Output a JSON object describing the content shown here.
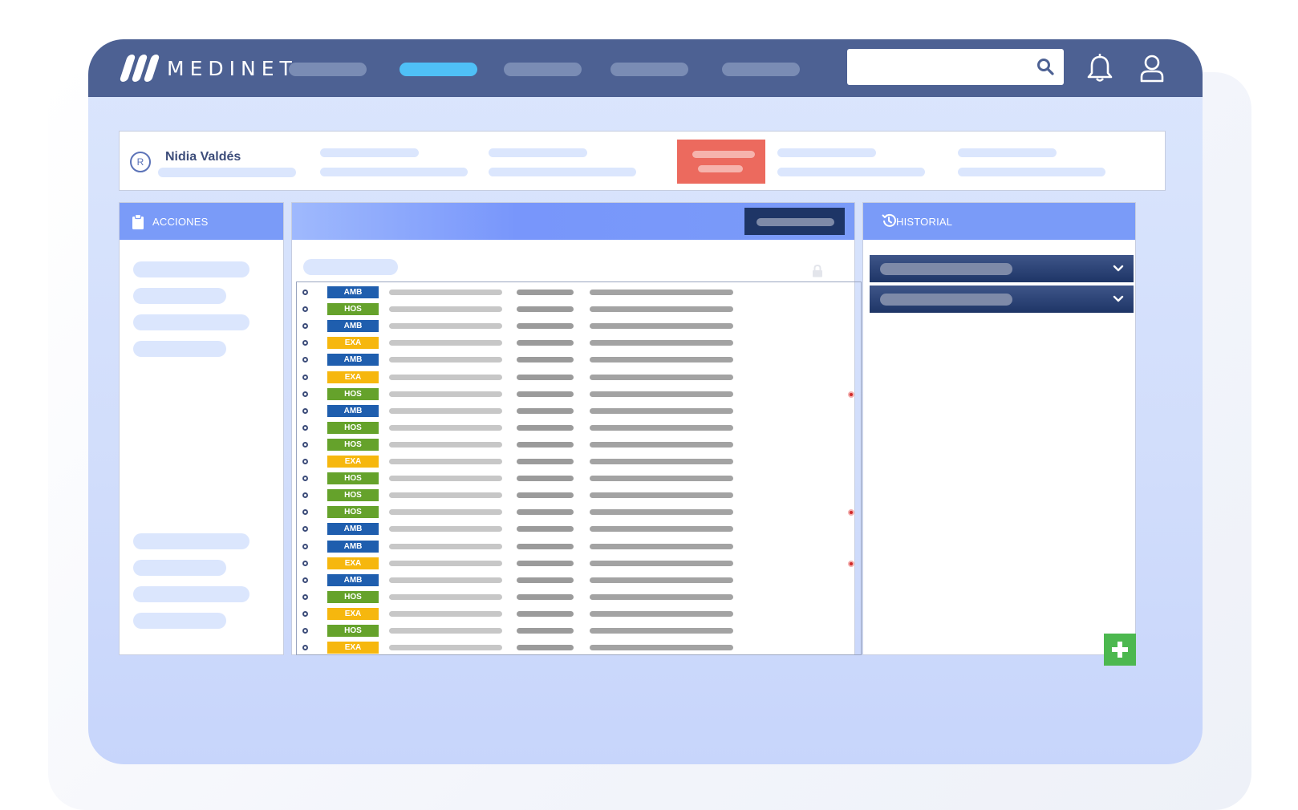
{
  "brand": {
    "logo_text": "MEDINET"
  },
  "patient": {
    "badge": "R",
    "name": "Nidia Valdés"
  },
  "panels": {
    "actions_title": "ACCIONES",
    "history_title": "HISTORIAL"
  },
  "encounters": [
    {
      "tag": "AMB",
      "alert": false
    },
    {
      "tag": "HOS",
      "alert": false
    },
    {
      "tag": "AMB",
      "alert": false
    },
    {
      "tag": "EXA",
      "alert": false
    },
    {
      "tag": "AMB",
      "alert": false
    },
    {
      "tag": "EXA",
      "alert": false
    },
    {
      "tag": "HOS",
      "alert": true
    },
    {
      "tag": "AMB",
      "alert": false
    },
    {
      "tag": "HOS",
      "alert": false
    },
    {
      "tag": "HOS",
      "alert": false
    },
    {
      "tag": "EXA",
      "alert": false
    },
    {
      "tag": "HOS",
      "alert": false
    },
    {
      "tag": "HOS",
      "alert": false
    },
    {
      "tag": "HOS",
      "alert": true
    },
    {
      "tag": "AMB",
      "alert": false
    },
    {
      "tag": "AMB",
      "alert": false
    },
    {
      "tag": "EXA",
      "alert": true
    },
    {
      "tag": "AMB",
      "alert": false
    },
    {
      "tag": "HOS",
      "alert": false
    },
    {
      "tag": "EXA",
      "alert": false
    },
    {
      "tag": "HOS",
      "alert": false
    },
    {
      "tag": "EXA",
      "alert": false
    }
  ],
  "icons": {
    "search": "search-icon",
    "bell": "bell-icon",
    "user": "user-icon",
    "actions": "clipboard-icon",
    "history": "history-icon",
    "lock": "lock-icon",
    "chevron": "chevron-down-icon",
    "add": "plus-icon"
  },
  "colors": {
    "topbar": "#4d6193",
    "nav_active": "#4fc0f7",
    "panel_header": "#7a9bf8",
    "alert_box": "#ec6a5e",
    "tag_amb": "#1f5eae",
    "tag_hos": "#65a22b",
    "tag_exa": "#f6b70e",
    "add_button": "#4cb84f"
  }
}
